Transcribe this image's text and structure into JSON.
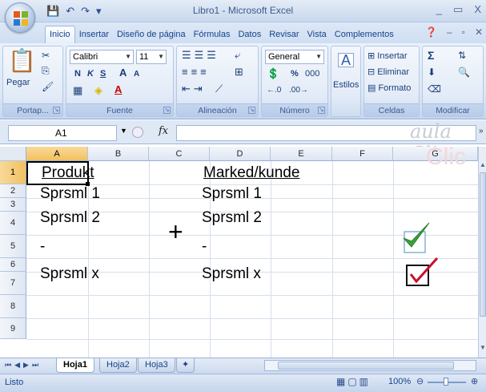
{
  "window": {
    "title": "Libro1 - Microsoft Excel",
    "controls": [
      "_",
      "▭",
      "X"
    ]
  },
  "qat": {
    "save": "💾",
    "undo": "↶",
    "redo": "↷",
    "customize": "▾"
  },
  "tabs": [
    "Inicio",
    "Insertar",
    "Diseño de página",
    "Fórmulas",
    "Datos",
    "Revisar",
    "Vista",
    "Complementos"
  ],
  "ribbon": {
    "clipboard": {
      "paste": "Pegar",
      "label": "Portap..."
    },
    "font": {
      "name": "Calibri",
      "size": "11",
      "bold": "N",
      "italic": "K",
      "underline": "S",
      "grow": "A",
      "shrink": "A",
      "label": "Fuente"
    },
    "alignment": {
      "label": "Alineación"
    },
    "number": {
      "format": "General",
      "percent": "%",
      "thousands": "000",
      "label": "Número"
    },
    "styles": {
      "label": "Estilos"
    },
    "cells": {
      "insert": "Insertar",
      "delete": "Eliminar",
      "format": "Formato",
      "label": "Celdas"
    },
    "editing": {
      "sum": "Σ",
      "label": "Modificar"
    }
  },
  "formula_bar": {
    "name_box": "A1",
    "fx": "fx",
    "watermark": "aula Clic"
  },
  "columns": [
    "A",
    "B",
    "C",
    "D",
    "E",
    "F",
    "G"
  ],
  "rows": [
    "1",
    "2",
    "3",
    "4",
    "5",
    "6",
    "7",
    "8",
    "9"
  ],
  "cells": {
    "a1": "Produkt",
    "a2": "Sprsml 1",
    "a3": "Sprsml 2",
    "a4": "-",
    "a5": "Sprsml x",
    "plus": "+",
    "d1": "Marked/kunde",
    "d2": "Sprsml 1",
    "d3": "Sprsml 2",
    "d4": "-",
    "d5": "Sprsml x"
  },
  "sheets": [
    "Hoja1",
    "Hoja2",
    "Hoja3"
  ],
  "status": {
    "ready": "Listo",
    "zoom": "100%"
  },
  "colors": {
    "check_green": "#3aa23a",
    "check_red": "#c8102e",
    "selection": "#f1c15f"
  }
}
